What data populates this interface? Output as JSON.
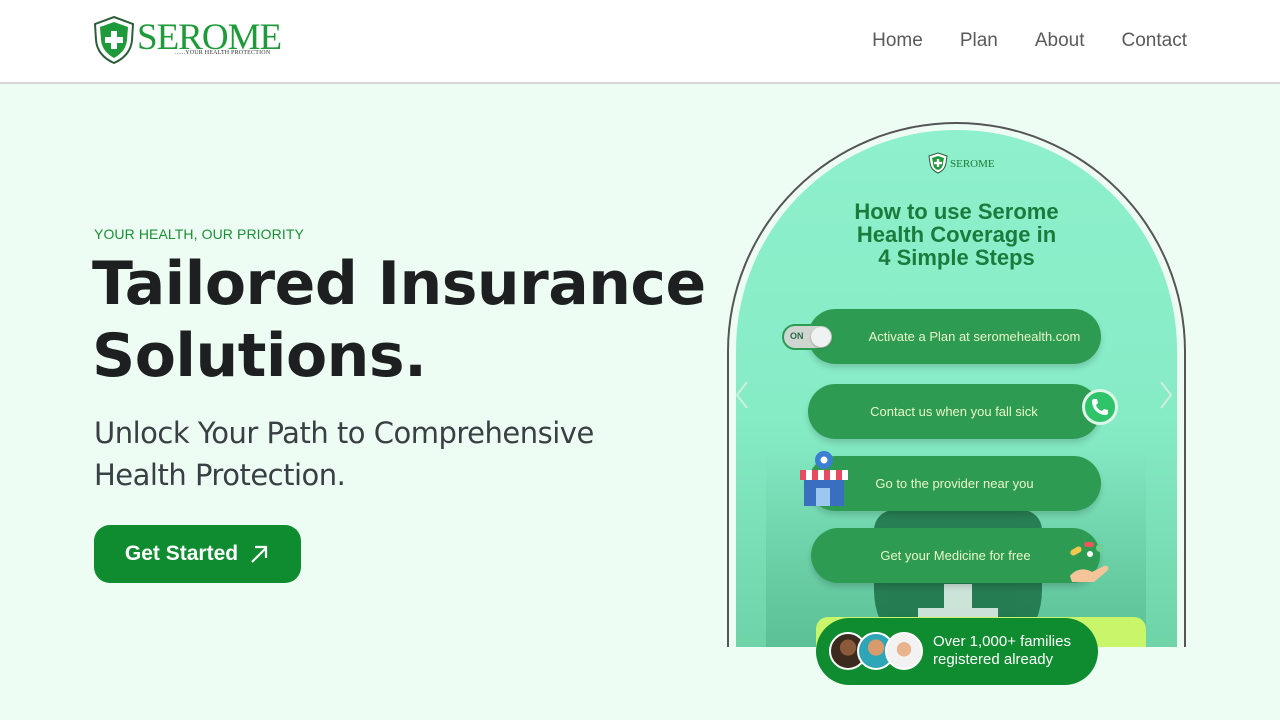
{
  "header": {
    "brand": "SEROME",
    "tagline": "......YOUR HEALTH PROTECTION",
    "nav": [
      "Home",
      "Plan",
      "About",
      "Contact"
    ]
  },
  "hero": {
    "eyebrow": "YOUR HEALTH, OUR PRIORITY",
    "headline_line1": "Tailored Insurance",
    "headline_line2": "Solutions.",
    "subhead_line1": "Unlock Your Path to Comprehensive",
    "subhead_line2": "Health Protection.",
    "cta_label": "Get Started",
    "cta_icon": "arrow-up-right-icon"
  },
  "card": {
    "brand": "SEROME",
    "title_line1": "How to use Serome",
    "title_line2": "Health Coverage in",
    "title_line3": "4 Simple Steps",
    "toggle_label": "ON",
    "steps": [
      "Activate a Plan at seromehealth.com",
      "Contact us when you fall sick",
      "Go to the provider near you",
      "Get your Medicine for free"
    ]
  },
  "families": {
    "line1": "Over 1,000+ families",
    "line2": "registered already"
  },
  "colors": {
    "brand_green": "#0f8c2f",
    "page_bg": "#eefdf4",
    "card_bg": "#8ef0cc",
    "step_bg": "#2e9b53"
  }
}
